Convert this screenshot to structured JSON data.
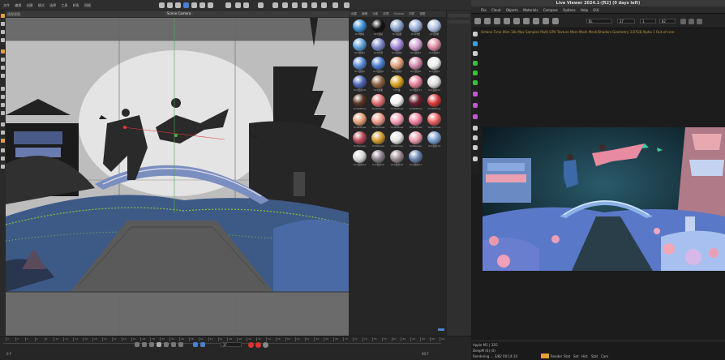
{
  "c4d": {
    "menu": [
      "文件",
      "编辑",
      "创建",
      "模式",
      "选择",
      "工具",
      "样条",
      "网格"
    ],
    "camera_label": "Scene Camera",
    "viewport_tab": "透视视图",
    "frame_label": "37",
    "timeline_end": "90 F",
    "timeline_start": "0 F",
    "ruler_ticks": [
      "0",
      "2",
      "4",
      "6",
      "8",
      "10",
      "12",
      "14",
      "16",
      "18",
      "20",
      "22",
      "24",
      "26",
      "28",
      "30",
      "32",
      "34",
      "36",
      "38",
      "40",
      "42",
      "44",
      "46",
      "48",
      "50",
      "52",
      "54",
      "56",
      "58",
      "60",
      "62",
      "64",
      "66",
      "68",
      "70",
      "72",
      "74",
      "76",
      "78",
      "80",
      "82",
      "84",
      "86",
      "88",
      "90"
    ],
    "materials_menu": [
      "创建",
      "编辑",
      "功能",
      "纹理",
      "Octane",
      "材质",
      "视图"
    ],
    "materials": [
      {
        "label": "Oct玻璃",
        "color": "#3e8fd6"
      },
      {
        "label": "Oct漫射",
        "color": "#111"
      },
      {
        "label": "Oct贴图",
        "color": "#8aa3c9"
      },
      {
        "label": "Oct材质",
        "color": "#9aaed6"
      },
      {
        "label": "Oct透明",
        "color": "#b0c4e6"
      },
      {
        "label": "Oct漫射1",
        "color": "#5ea0d8"
      },
      {
        "label": "Oct光泽",
        "color": "#7b86c7"
      },
      {
        "label": "Oct漫射2",
        "color": "#a287d6"
      },
      {
        "label": "Oct漫射3",
        "color": "#d0a2d2"
      },
      {
        "label": "Oct漫射4",
        "color": "#e08ca2"
      },
      {
        "label": "Oct漫射5",
        "color": "#5a8bd6"
      },
      {
        "label": "Oct漫射6",
        "color": "#4a7fd0"
      },
      {
        "label": "Oct漫射7",
        "color": "#e0a07c"
      },
      {
        "label": "Oct漫射8",
        "color": "#d48ab0"
      },
      {
        "label": "Oct漫射9",
        "color": "#eeeeee"
      },
      {
        "label": "Oct漫射10",
        "color": "#4d66b6"
      },
      {
        "label": "Oct金属",
        "color": "#8a6042"
      },
      {
        "label": "Oct金",
        "color": "#d8a020"
      },
      {
        "label": "Oct漫射11",
        "color": "#e6829a"
      },
      {
        "label": "Oct漫射12",
        "color": "#e0e0e0"
      },
      {
        "label": "OctDiffuse",
        "color": "#5c3422"
      },
      {
        "label": "OctDiffuse",
        "color": "#e07070"
      },
      {
        "label": "OctDiffuse",
        "color": "#f2f2f2"
      },
      {
        "label": "OctDiffuse",
        "color": "#6a2030"
      },
      {
        "label": "OctDiffuse",
        "color": "#d83a3a"
      },
      {
        "label": "OctDiffuse",
        "color": "#e6a07a"
      },
      {
        "label": "OctDiffuse",
        "color": "#ee9a8a"
      },
      {
        "label": "OctDiffuse",
        "color": "#f4a0b4"
      },
      {
        "label": "OctDiffuse",
        "color": "#f080a0"
      },
      {
        "label": "OctDiffuse",
        "color": "#ee6060"
      },
      {
        "label": "OctGlossy",
        "color": "#b84a5a"
      },
      {
        "label": "OctGlossy",
        "color": "#d29a30"
      },
      {
        "label": "OctGlossy",
        "color": "#e6e6e6"
      },
      {
        "label": "OctGlossy",
        "color": "#e89aa8"
      },
      {
        "label": "Oct漫射13",
        "color": "#7aa0d0"
      },
      {
        "label": "Oct漫射14",
        "color": "#d8d8d8"
      },
      {
        "label": "Oct漫射15",
        "color": "#8a7f8a"
      },
      {
        "label": "Oct漫射16",
        "color": "#9a8a92"
      },
      {
        "label": "Oct漫射17",
        "color": "#6a86b0"
      }
    ]
  },
  "liveviewer": {
    "title": "Live Viewer 2024.1-[R2] (0 days left)",
    "menu": [
      "File",
      "Cloud",
      "Objects",
      "Materials",
      "Compare",
      "Options",
      "Help",
      "GUI"
    ],
    "mode": "DL",
    "fps": "37",
    "frame": "1",
    "max": "82",
    "info": "Octane Time 06m 18s  Max Samples  Multi GPU  Texture Mem  Mesh Mesh/Shaders  Geometry 3.87GB  Alpha 1  Out-of-core",
    "status_lines": [
      "Apple M1 | 32G",
      "DeepM (6) (4)",
      "Rendering ...  3/82  00:14:10"
    ],
    "status_btns": [
      "Render",
      "Stat",
      "Set",
      "Hist",
      "Stat",
      "Cam"
    ]
  }
}
